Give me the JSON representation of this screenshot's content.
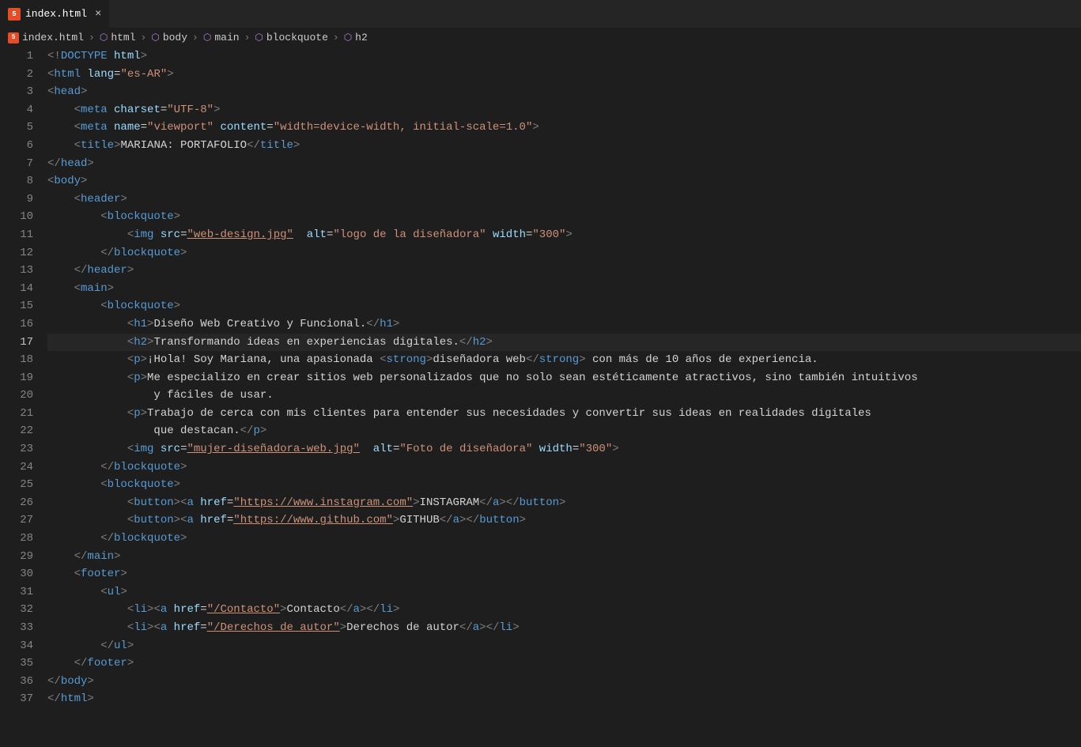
{
  "tab": {
    "label": "index.html",
    "icon_text": "5"
  },
  "breadcrumbs": [
    {
      "kind": "file",
      "text": "index.html",
      "icon_text": "5"
    },
    {
      "kind": "node",
      "text": "html"
    },
    {
      "kind": "node",
      "text": "body"
    },
    {
      "kind": "node",
      "text": "main"
    },
    {
      "kind": "node",
      "text": "blockquote"
    },
    {
      "kind": "node",
      "text": "h2"
    }
  ],
  "active_line": 17,
  "line_count": 37,
  "code": {
    "l1": {
      "doctype": "DOCTYPE",
      "html": "html"
    },
    "l2": {
      "tag": "html",
      "attr": "lang",
      "val": "\"es-AR\""
    },
    "l3": {
      "tag": "head"
    },
    "l4": {
      "tag": "meta",
      "attr1": "charset",
      "val1": "\"UTF-8\""
    },
    "l5": {
      "tag": "meta",
      "attr1": "name",
      "val1": "\"viewport\"",
      "attr2": "content",
      "val2": "\"width=device-width, initial-scale=1.0\""
    },
    "l6": {
      "open": "title",
      "text": "MARIANA: PORTAFOLIO",
      "close": "title"
    },
    "l7": {
      "close": "head"
    },
    "l8": {
      "tag": "body"
    },
    "l9": {
      "tag": "header"
    },
    "l10": {
      "tag": "blockquote"
    },
    "l11": {
      "tag": "img",
      "a1": "src",
      "v1": "\"web-design.jpg\"",
      "a2": "alt",
      "v2": "\"logo de la diseñadora\"",
      "a3": "width",
      "v3": "\"300\""
    },
    "l12": {
      "close": "blockquote"
    },
    "l13": {
      "close": "header"
    },
    "l14": {
      "tag": "main"
    },
    "l15": {
      "tag": "blockquote"
    },
    "l16": {
      "open": "h1",
      "text": "Diseño Web Creativo y Funcional.",
      "close": "h1"
    },
    "l17": {
      "open": "h2",
      "text": "Transformando ideas en experiencias digitales.",
      "close": "h2"
    },
    "l18": {
      "open": "p",
      "t1": "¡Hola! Soy Mariana, una apasionada ",
      "strong": "strong",
      "t2": "diseñadora web",
      "t3": " con más de 10 años de experiencia."
    },
    "l19": {
      "open": "p",
      "text": "Me especializo en crear sitios web personalizados que no solo sean estéticamente atractivos, sino también intuitivos"
    },
    "l20": {
      "text": "y fáciles de usar."
    },
    "l21": {
      "open": "p",
      "text": "Trabajo de cerca con mis clientes para entender sus necesidades y convertir sus ideas en realidades digitales"
    },
    "l22": {
      "text": "que destacan.",
      "close": "p"
    },
    "l23": {
      "tag": "img",
      "a1": "src",
      "v1": "\"mujer-diseñadora-web.jpg\"",
      "a2": "alt",
      "v2": "\"Foto de diseñadora\"",
      "a3": "width",
      "v3": "\"300\""
    },
    "l24": {
      "close": "blockquote"
    },
    "l25": {
      "tag": "blockquote"
    },
    "l26": {
      "btn": "button",
      "atag": "a",
      "attr": "href",
      "val": "\"https://www.instagram.com\"",
      "text": "INSTAGRAM"
    },
    "l27": {
      "btn": "button",
      "atag": "a",
      "attr": "href",
      "val": "\"https://www.github.com\"",
      "text": "GITHUB"
    },
    "l28": {
      "close": "blockquote"
    },
    "l29": {
      "close": "main"
    },
    "l30": {
      "tag": "footer"
    },
    "l31": {
      "tag": "ul"
    },
    "l32": {
      "li": "li",
      "atag": "a",
      "attr": "href",
      "val": "\"/Contacto\"",
      "text": "Contacto"
    },
    "l33": {
      "li": "li",
      "atag": "a",
      "attr": "href",
      "val": "\"/Derechos de autor\"",
      "text": "Derechos de autor"
    },
    "l34": {
      "close": "ul"
    },
    "l35": {
      "close": "footer"
    },
    "l36": {
      "close": "body"
    },
    "l37": {
      "close": "html"
    }
  }
}
